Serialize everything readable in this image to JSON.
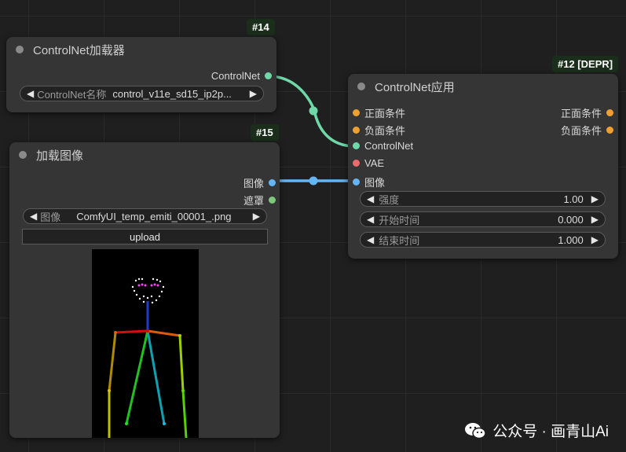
{
  "colors": {
    "controlnet_socket": "#6fd8a8",
    "image_socket": "#64b5f6",
    "mask_socket": "#7ec87e",
    "conditioning_socket": "#f0a030",
    "vae_socket": "#ee6b6b"
  },
  "node14": {
    "badge": "#14",
    "title": "ControlNet加载器",
    "output_label": "ControlNet",
    "widget": {
      "label": "ControlNet名称",
      "value": "control_v11e_sd15_ip2p..."
    }
  },
  "node15": {
    "badge": "#15",
    "title": "加载图像",
    "output_image": "图像",
    "output_mask": "遮罩",
    "widget": {
      "label": "图像",
      "value": "ComfyUI_temp_emiti_00001_.png"
    },
    "upload_label": "upload"
  },
  "node12": {
    "badge": "#12 [DEPR]",
    "title": "ControlNet应用",
    "inputs": [
      "正面条件",
      "负面条件",
      "ControlNet",
      "VAE",
      "图像"
    ],
    "outputs": [
      "正面条件",
      "负面条件"
    ],
    "strength": {
      "label": "强度",
      "value": "1.00"
    },
    "start": {
      "label": "开始时间",
      "value": "0.000"
    },
    "end": {
      "label": "结束时间",
      "value": "1.000"
    }
  },
  "watermark": {
    "text": "公众号 · 画青山Ai",
    "icon": "wechat-icon"
  }
}
